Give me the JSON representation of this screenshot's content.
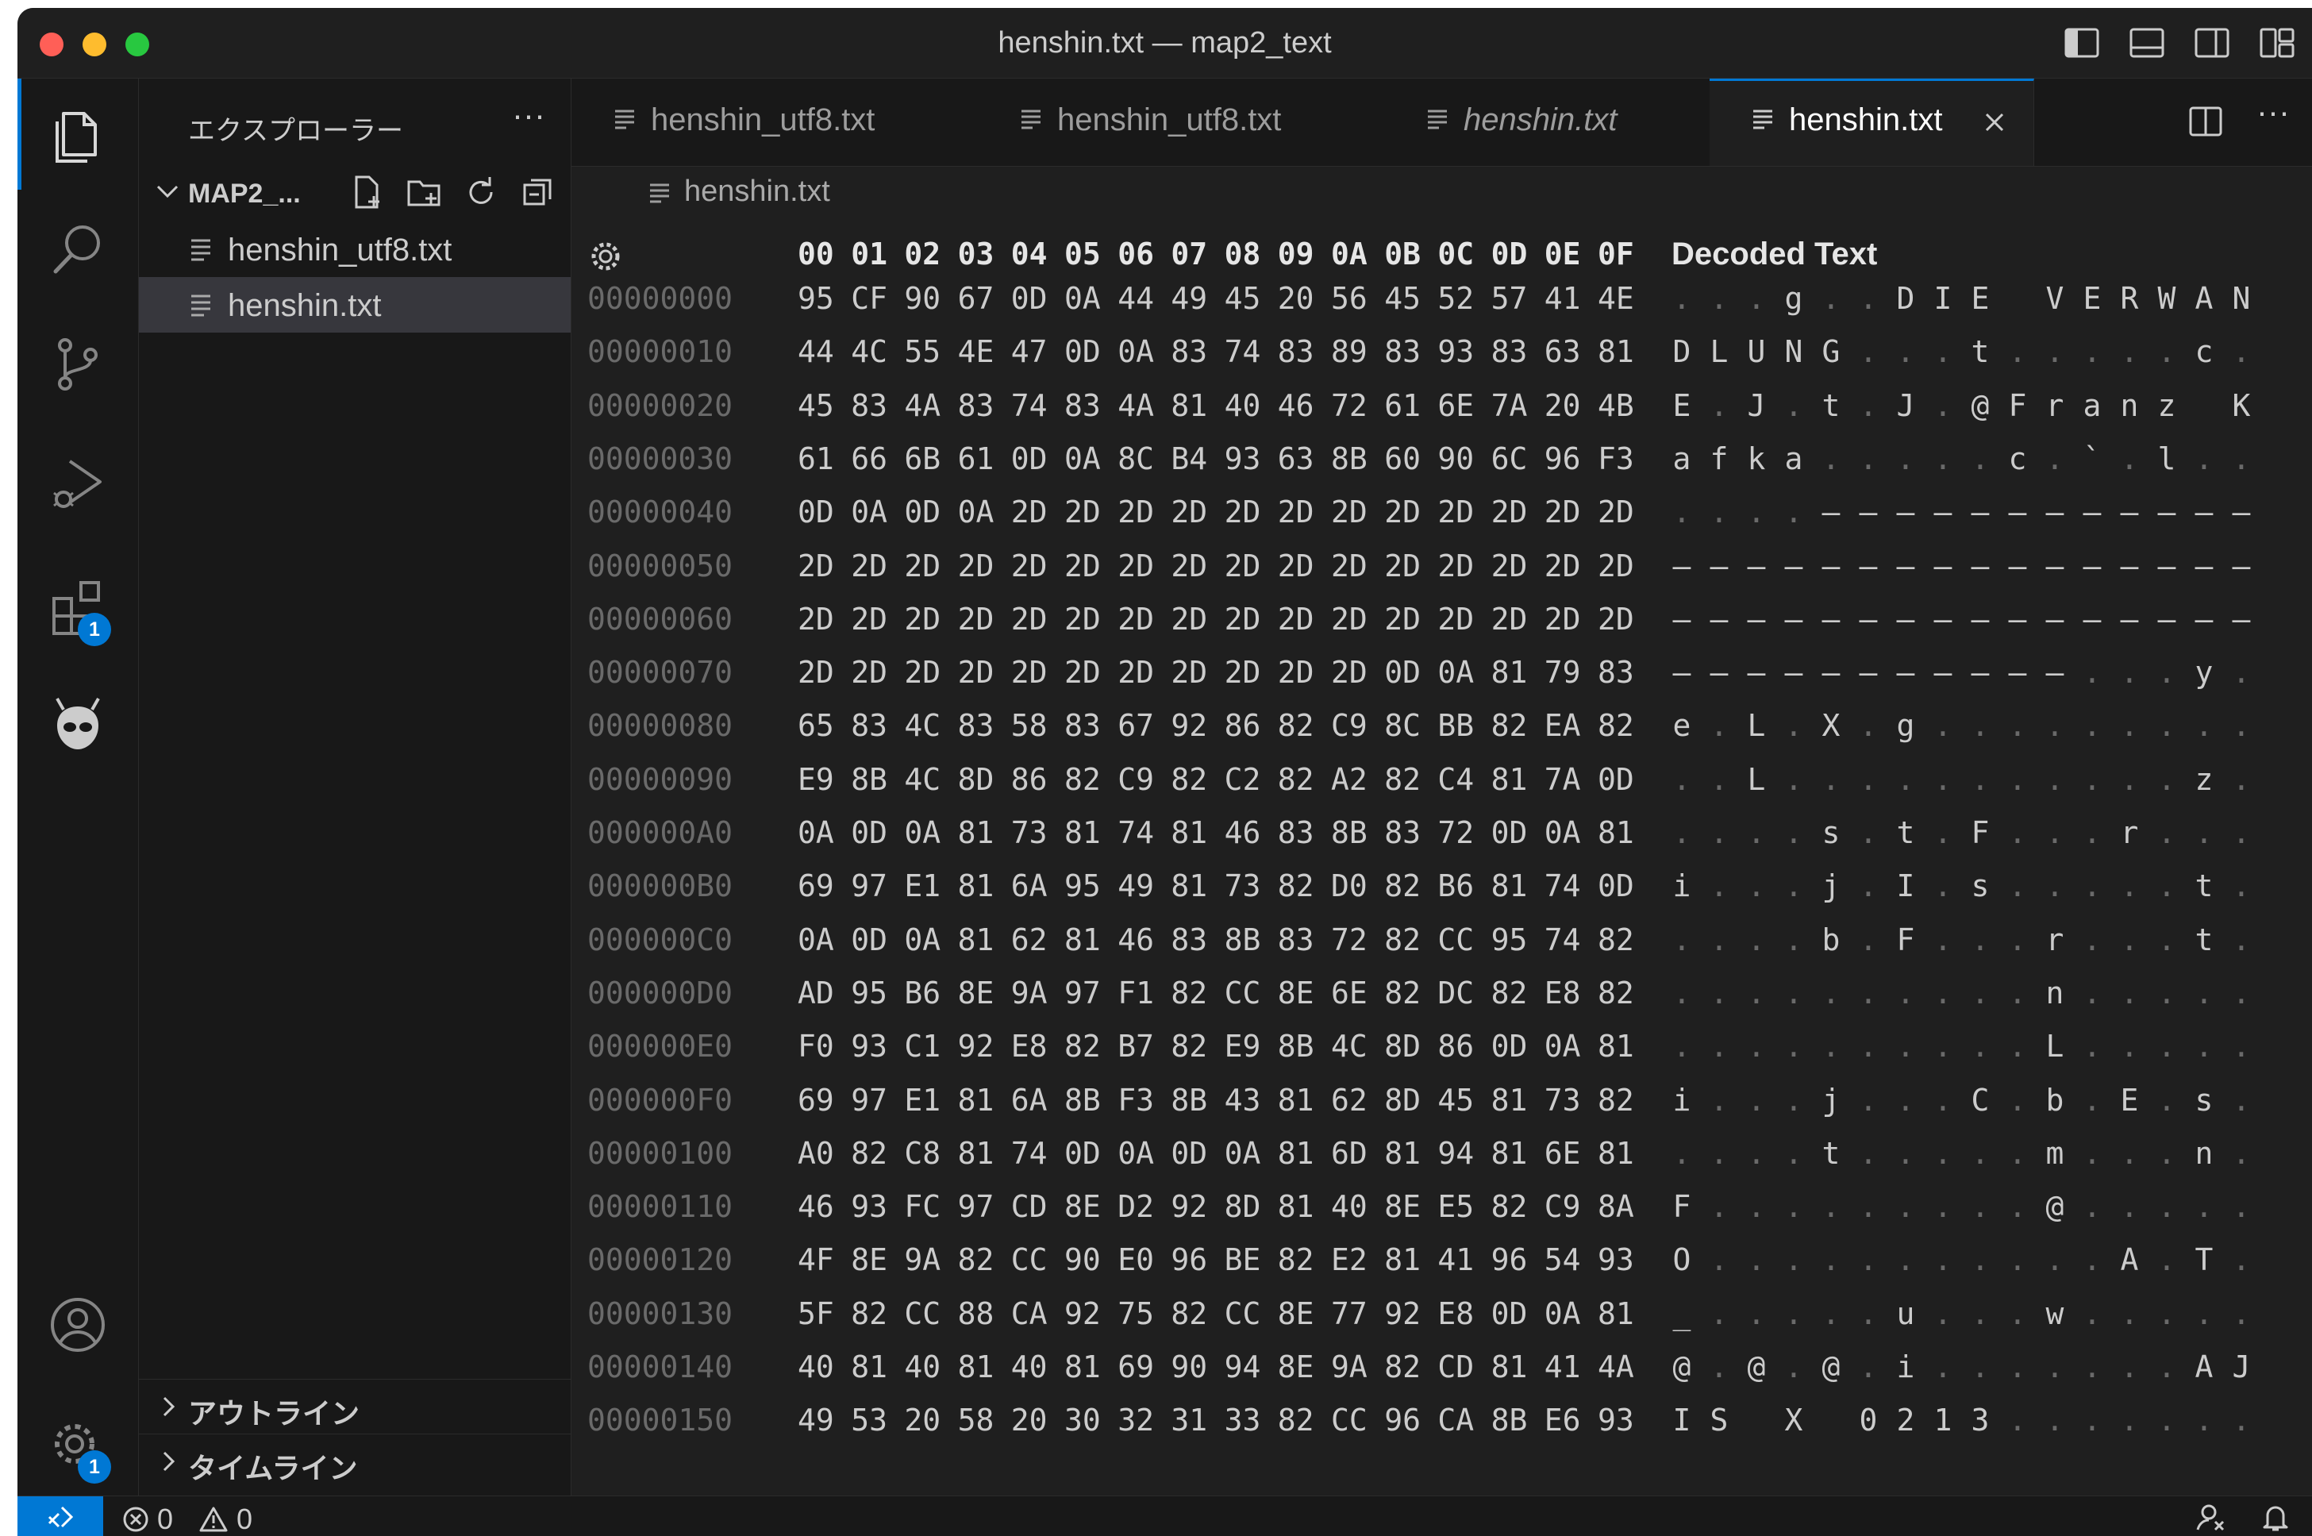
{
  "window": {
    "title": "henshin.txt — map2_text"
  },
  "activity_bar": {
    "extensions_badge": "1",
    "manage_badge": "1"
  },
  "sidebar": {
    "title": "エクスプローラー",
    "more": "···",
    "folder": "MAP2_...",
    "files": [
      {
        "name": "henshin_utf8.txt",
        "selected": false
      },
      {
        "name": "henshin.txt",
        "selected": true
      }
    ],
    "sections": [
      "アウトライン",
      "タイムライン"
    ]
  },
  "tabs": [
    {
      "label": "henshin_utf8.txt",
      "italic": false,
      "active": false
    },
    {
      "label": "henshin_utf8.txt",
      "italic": false,
      "active": false
    },
    {
      "label": "henshin.txt",
      "italic": true,
      "active": false
    },
    {
      "label": "henshin.txt",
      "italic": false,
      "active": true
    }
  ],
  "tab_more": "···",
  "breadcrumb": "henshin.txt",
  "hex_editor": {
    "header_bytes": [
      "00",
      "01",
      "02",
      "03",
      "04",
      "05",
      "06",
      "07",
      "08",
      "09",
      "0A",
      "0B",
      "0C",
      "0D",
      "0E",
      "0F"
    ],
    "decoded_header": "Decoded Text",
    "rows": [
      {
        "offset": "00000000",
        "bytes": "95 CF 90 67 0D 0A 44 49 45 20 56 45 52 57 41 4E",
        "decoded": "...g..DIE VERWAN"
      },
      {
        "offset": "00000010",
        "bytes": "44 4C 55 4E 47 0D 0A 83 74 83 89 83 93 83 63 81",
        "decoded": "DLUNG...t.....c."
      },
      {
        "offset": "00000020",
        "bytes": "45 83 4A 83 74 83 4A 81 40 46 72 61 6E 7A 20 4B",
        "decoded": "E.J.t.J.@Franz K"
      },
      {
        "offset": "00000030",
        "bytes": "61 66 6B 61 0D 0A 8C B4 93 63 8B 60 90 6C 96 F3",
        "decoded": "afka.....c.`.l.."
      },
      {
        "offset": "00000040",
        "bytes": "0D 0A 0D 0A 2D 2D 2D 2D 2D 2D 2D 2D 2D 2D 2D 2D",
        "decoded": "....------------"
      },
      {
        "offset": "00000050",
        "bytes": "2D 2D 2D 2D 2D 2D 2D 2D 2D 2D 2D 2D 2D 2D 2D 2D",
        "decoded": "----------------"
      },
      {
        "offset": "00000060",
        "bytes": "2D 2D 2D 2D 2D 2D 2D 2D 2D 2D 2D 2D 2D 2D 2D 2D",
        "decoded": "----------------"
      },
      {
        "offset": "00000070",
        "bytes": "2D 2D 2D 2D 2D 2D 2D 2D 2D 2D 2D 0D 0A 81 79 83",
        "decoded": "-----------...y."
      },
      {
        "offset": "00000080",
        "bytes": "65 83 4C 83 58 83 67 92 86 82 C9 8C BB 82 EA 82",
        "decoded": "e.L.X.g........."
      },
      {
        "offset": "00000090",
        "bytes": "E9 8B 4C 8D 86 82 C9 82 C2 82 A2 82 C4 81 7A 0D",
        "decoded": "..L...........z."
      },
      {
        "offset": "000000A0",
        "bytes": "0A 0D 0A 81 73 81 74 81 46 83 8B 83 72 0D 0A 81",
        "decoded": "....s.t.F...r..."
      },
      {
        "offset": "000000B0",
        "bytes": "69 97 E1 81 6A 95 49 81 73 82 D0 82 B6 81 74 0D",
        "decoded": "i...j.I.s.....t."
      },
      {
        "offset": "000000C0",
        "bytes": "0A 0D 0A 81 62 81 46 83 8B 83 72 82 CC 95 74 82",
        "decoded": "....b.F...r...t."
      },
      {
        "offset": "000000D0",
        "bytes": "AD 95 B6 8E 9A 97 F1 82 CC 8E 6E 82 DC 82 E8 82",
        "decoded": "..........n....."
      },
      {
        "offset": "000000E0",
        "bytes": "F0 93 C1 92 E8 82 B7 82 E9 8B 4C 8D 86 0D 0A 81",
        "decoded": "..........L....."
      },
      {
        "offset": "000000F0",
        "bytes": "69 97 E1 81 6A 8B F3 8B 43 81 62 8D 45 81 73 82",
        "decoded": "i...j...C.b.E.s."
      },
      {
        "offset": "00000100",
        "bytes": "A0 82 C8 81 74 0D 0A 0D 0A 81 6D 81 94 81 6E 81",
        "decoded": "....t.....m...n."
      },
      {
        "offset": "00000110",
        "bytes": "46 93 FC 97 CD 8E D2 92 8D 81 40 8E E5 82 C9 8A",
        "decoded": "F.........@....."
      },
      {
        "offset": "00000120",
        "bytes": "4F 8E 9A 82 CC 90 E0 96 BE 82 E2 81 41 96 54 93",
        "decoded": "O...........A.T."
      },
      {
        "offset": "00000130",
        "bytes": "5F 82 CC 88 CA 92 75 82 CC 8E 77 92 E8 0D 0A 81",
        "decoded": "_.....u...w....."
      },
      {
        "offset": "00000140",
        "bytes": "40 81 40 81 40 81 69 90 94 8E 9A 82 CD 81 41 4A",
        "decoded": "@.@.@.i.......AJ"
      },
      {
        "offset": "00000150",
        "bytes": "49 53 20 58 20 30 32 31 33 82 CC 96 CA 8B E6 93",
        "decoded": "IS X 0213......."
      }
    ]
  },
  "status_bar": {
    "errors": "0",
    "warnings": "0"
  },
  "colors": {
    "accent": "#0078d4",
    "close": "#ff5f57",
    "minimize": "#febc2e",
    "zoom": "#28c840"
  }
}
